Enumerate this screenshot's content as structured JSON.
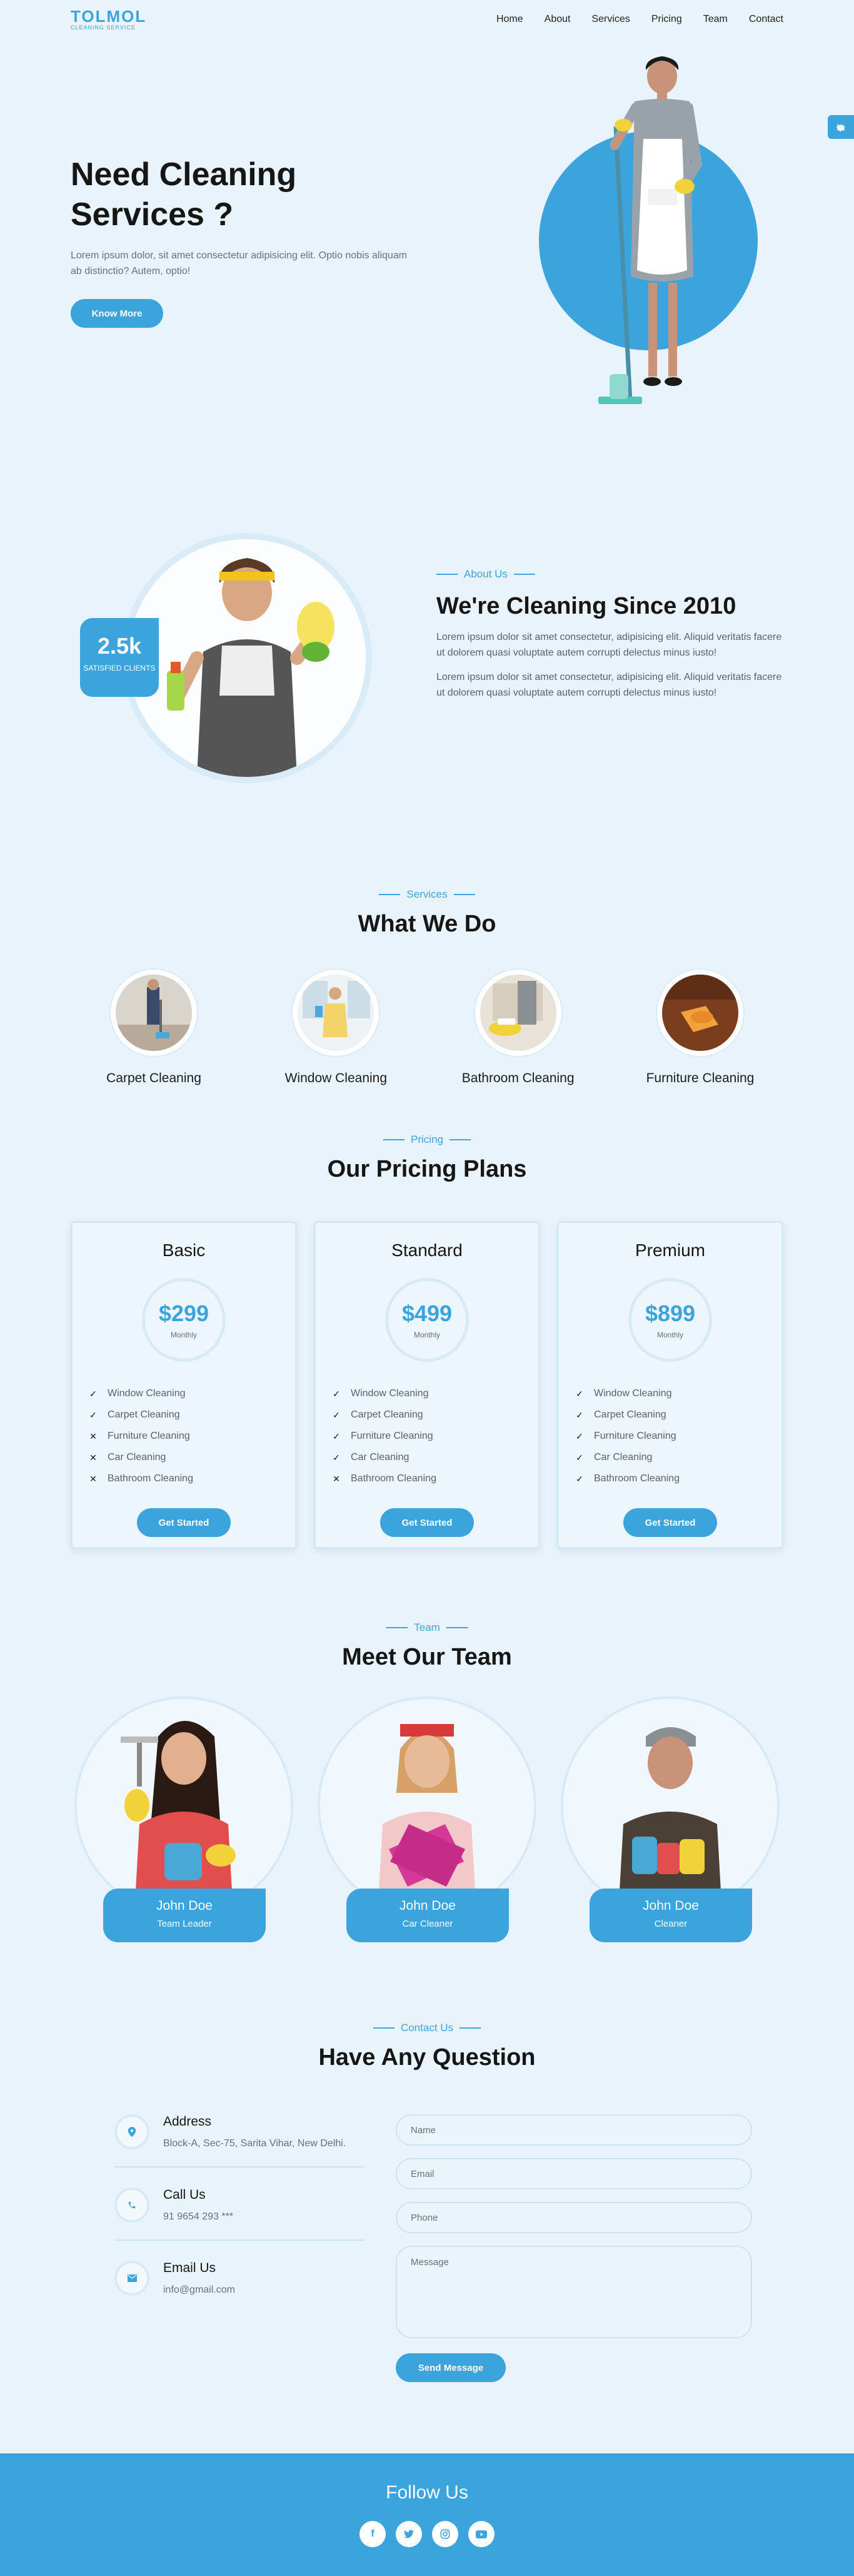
{
  "logo": {
    "title": "TOLMOL",
    "subtitle": "CLEANING SERVICE"
  },
  "nav": {
    "items": [
      "Home",
      "About",
      "Services",
      "Pricing",
      "Team",
      "Contact"
    ]
  },
  "settings_icon": "gear-icon",
  "hero": {
    "title": "Need Cleaning Services ?",
    "text": "Lorem ipsum dolor, sit amet consectetur adipisicing elit. Optio nobis aliquam ab distinctio? Autem, optio!",
    "button": "Know More"
  },
  "about": {
    "kicker": "About Us",
    "title": "We're Cleaning Since 2010",
    "p1": "Lorem ipsum dolor sit amet consectetur, adipisicing elit. Aliquid veritatis facere ut dolorem quasi voluptate autem corrupti delectus minus iusto!",
    "p2": "Lorem ipsum dolor sit amet consectetur, adipisicing elit. Aliquid veritatis facere ut dolorem quasi voluptate autem corrupti delectus minus iusto!",
    "stat_number": "2.5k",
    "stat_label": "SATISFIED CLIENTS"
  },
  "services": {
    "kicker": "Services",
    "title": "What We Do",
    "items": [
      "Carpet Cleaning",
      "Window Cleaning",
      "Bathroom Cleaning",
      "Furniture Cleaning"
    ]
  },
  "pricing": {
    "kicker": "Pricing",
    "title": "Our Pricing Plans",
    "plans": [
      {
        "name": "Basic",
        "price": "$299",
        "period": "Monthly",
        "button": "Get Started",
        "features": [
          {
            "label": "Window Cleaning",
            "included": "✓"
          },
          {
            "label": "Carpet Cleaning",
            "included": "✓"
          },
          {
            "label": "Furniture Cleaning",
            "included": "✕"
          },
          {
            "label": "Car Cleaning",
            "included": "✕"
          },
          {
            "label": "Bathroom Cleaning",
            "included": "✕"
          }
        ]
      },
      {
        "name": "Standard",
        "price": "$499",
        "period": "Monthly",
        "button": "Get Started",
        "features": [
          {
            "label": "Window Cleaning",
            "included": "✓"
          },
          {
            "label": "Carpet Cleaning",
            "included": "✓"
          },
          {
            "label": "Furniture Cleaning",
            "included": "✓"
          },
          {
            "label": "Car Cleaning",
            "included": "✓"
          },
          {
            "label": "Bathroom Cleaning",
            "included": "✕"
          }
        ]
      },
      {
        "name": "Premium",
        "price": "$899",
        "period": "Monthly",
        "button": "Get Started",
        "features": [
          {
            "label": "Window Cleaning",
            "included": "✓"
          },
          {
            "label": "Carpet Cleaning",
            "included": "✓"
          },
          {
            "label": "Furniture Cleaning",
            "included": "✓"
          },
          {
            "label": "Car Cleaning",
            "included": "✓"
          },
          {
            "label": "Bathroom Cleaning",
            "included": "✓"
          }
        ]
      }
    ]
  },
  "team": {
    "kicker": "Team",
    "title": "Meet Our Team",
    "members": [
      {
        "name": "John Doe",
        "role": "Team Leader"
      },
      {
        "name": "John Doe",
        "role": "Car Cleaner"
      },
      {
        "name": "John Doe",
        "role": "Cleaner"
      }
    ]
  },
  "contact": {
    "kicker": "Contact Us",
    "title": "Have Any Question",
    "address_title": "Address",
    "address_value": "Block-A, Sec-75, Sarita Vihar, New Delhi.",
    "call_title": "Call Us",
    "call_value": "91 9654 293 ***",
    "email_title": "Email Us",
    "email_value": "info@gmail.com",
    "form": {
      "name": "Name",
      "email": "Email",
      "phone": "Phone",
      "message": "Message",
      "button": "Send Message"
    }
  },
  "footer": {
    "title": "Follow Us",
    "socials": [
      "facebook-icon",
      "twitter-icon",
      "instagram-icon",
      "youtube-icon"
    ]
  },
  "colors": {
    "accent": "#3ba4dc",
    "background": "#e8f3fb"
  }
}
